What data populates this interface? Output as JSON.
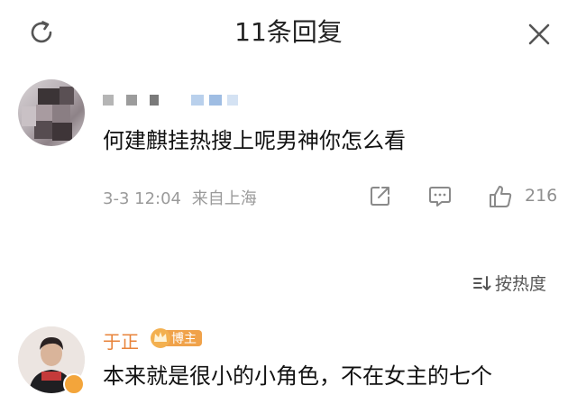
{
  "header": {
    "title": "11条回复",
    "refresh_icon": "refresh-icon",
    "close_icon": "close-icon"
  },
  "comments": [
    {
      "username": "",
      "avatar": "pixelated-avatar",
      "text": "何建麒挂热搜上呢男神你怎么看",
      "date": "3-3 12:04",
      "location": "来自上海",
      "likes": "216",
      "actions": [
        "share-icon",
        "comment-icon",
        "thumbs-up-icon"
      ]
    },
    {
      "username": "于正",
      "badge": "博主",
      "avatar": "avatar-photo",
      "text": "本来就是很小的小角色，不在女主的七个"
    }
  ],
  "sort": {
    "label": "按热度",
    "icon": "sort-icon"
  },
  "colors": {
    "accent": "#e8833a",
    "badge": "#f0a24a",
    "meta": "#9a9a9a"
  }
}
